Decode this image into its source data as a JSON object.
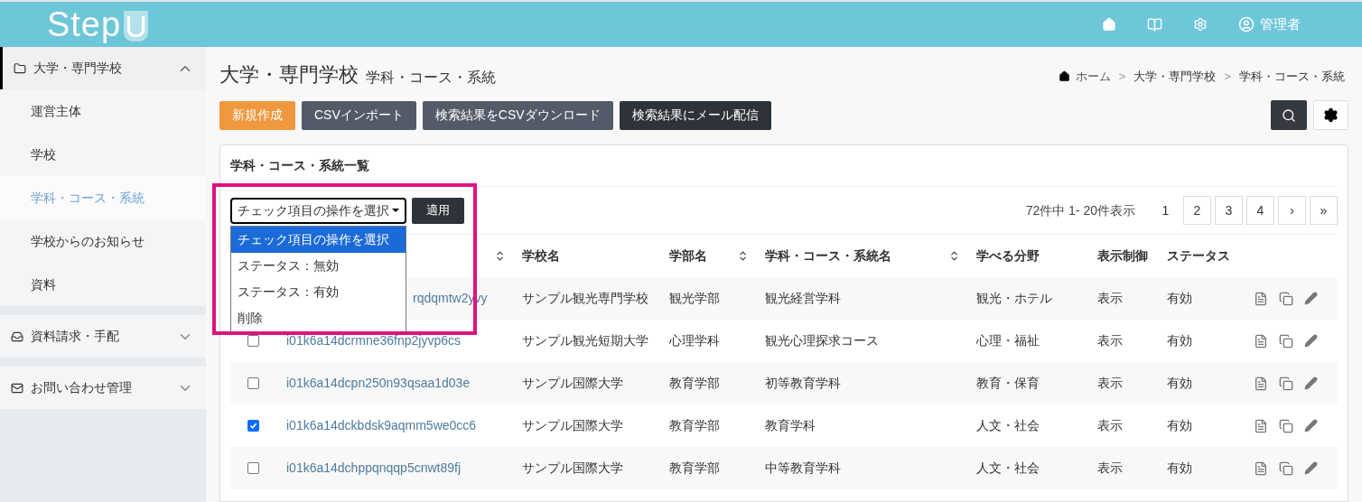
{
  "header": {
    "logo_text": "Step",
    "logo_mark": "U",
    "user": "管理者"
  },
  "sidebar": {
    "groups": [
      {
        "label": "大学・専門学校",
        "expanded": true,
        "children": [
          {
            "label": "運営主体",
            "selected": false
          },
          {
            "label": "学校",
            "selected": false
          },
          {
            "label": "学科・コース・系統",
            "selected": true
          },
          {
            "label": "学校からのお知らせ",
            "selected": false
          },
          {
            "label": "資料",
            "selected": false
          }
        ]
      },
      {
        "label": "資料請求・手配",
        "expanded": false
      },
      {
        "label": "お問い合わせ管理",
        "expanded": false
      }
    ]
  },
  "page": {
    "title": "大学・専門学校",
    "subtitle": "学科・コース・系統",
    "breadcrumb": [
      "ホーム",
      "大学・専門学校",
      "学科・コース・系統"
    ],
    "separator": ">"
  },
  "toolbar": [
    {
      "label": "新規作成",
      "kind": "primary"
    },
    {
      "label": "CSVインポート",
      "kind": "secondary"
    },
    {
      "label": "検索結果をCSVダウンロード",
      "kind": "secondary"
    },
    {
      "label": "検索結果にメール配信",
      "kind": "dark"
    }
  ],
  "card": {
    "title": "学科・コース・系統一覧",
    "bulk_select": {
      "value": "チェック項目の操作を選択",
      "options": [
        {
          "label": "チェック項目の操作を選択",
          "selected": true
        },
        {
          "label": "ステータス：無効",
          "selected": false
        },
        {
          "label": "ステータス：有効",
          "selected": false
        },
        {
          "label": "削除",
          "selected": false
        }
      ]
    },
    "apply": "適用",
    "summary": "72件中 1- 20件表示",
    "pages": [
      {
        "label": "1",
        "selected": true
      },
      {
        "label": "2",
        "selected": false
      },
      {
        "label": "3",
        "selected": false
      },
      {
        "label": "4",
        "selected": false
      },
      {
        "label": "›",
        "selected": false
      },
      {
        "label": "»",
        "selected": false
      }
    ],
    "columns": [
      {
        "sortable": true
      },
      {
        "label": "学校名",
        "sortable": false
      },
      {
        "label": "学部名",
        "sortable": true
      },
      {
        "label": "学科・コース・系統名",
        "sortable": true
      },
      {
        "label": "学べる分野",
        "sortable": false
      },
      {
        "label": "表示制御",
        "sortable": false
      },
      {
        "label": "ステータス",
        "sortable": false
      }
    ],
    "rows": [
      {
        "covered": true,
        "cells": [
          "rqdqmtw2yvy",
          "サンプル観光専門学校",
          "観光学部",
          "観光経営学科",
          "観光・ホテル",
          "表示",
          "有効"
        ]
      },
      {
        "checked": false,
        "covered": false,
        "cells": [
          "i01k6a14dcrmne36fnp2jyvp6cs",
          "サンプル観光短期大学",
          "心理学科",
          "観光心理探求コース",
          "心理・福祉",
          "表示",
          "有効"
        ]
      },
      {
        "checked": false,
        "covered": false,
        "cells": [
          "i01k6a14dcpn250n93qsaa1d03e",
          "サンプル国際大学",
          "教育学部",
          "初等教育学科",
          "教育・保育",
          "表示",
          "有効"
        ]
      },
      {
        "checked": true,
        "covered": false,
        "cells": [
          "i01k6a14dckbdsk9aqmm5we0cc6",
          "サンプル国際大学",
          "教育学部",
          "教育学科",
          "人文・社会",
          "表示",
          "有効"
        ]
      },
      {
        "checked": false,
        "covered": false,
        "cells": [
          "i01k6a14dchppqnqqp5cnwt89fj",
          "サンプル国際大学",
          "教育学部",
          "中等教育学科",
          "人文・社会",
          "表示",
          "有効"
        ]
      }
    ]
  }
}
